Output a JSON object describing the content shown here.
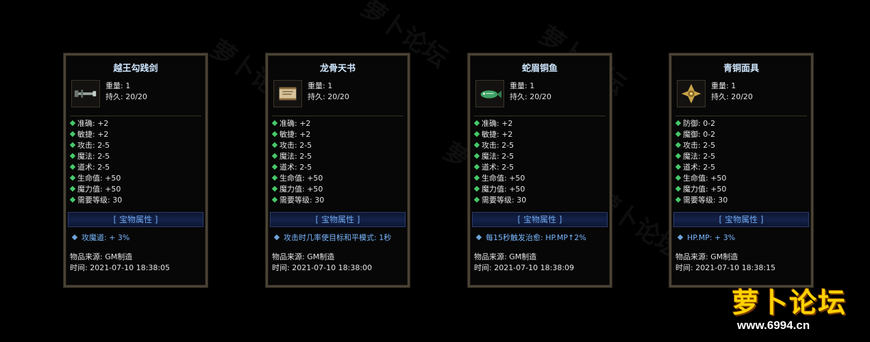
{
  "cards": [
    {
      "title": "越王勾践剑",
      "weight": "重量: 1",
      "durability": "持久: 20/20",
      "stats": [
        "准确: +2",
        "敏捷: +2",
        "攻击: 2-5",
        "魔法: 2-5",
        "道术: 2-5",
        "生命值: +50",
        "魔力值: +50",
        "需要等级: 30"
      ],
      "attr_title": "[ 宝物属性 ]",
      "special": "攻魔道: + 3%",
      "source": "物品来源: GM制造",
      "time": "时间: 2021-07-10 18:38:05",
      "icon": "sword-icon"
    },
    {
      "title": "龙骨天书",
      "weight": "重量: 1",
      "durability": "持久: 20/20",
      "stats": [
        "准确: +2",
        "敏捷: +2",
        "攻击: 2-5",
        "魔法: 2-5",
        "道术: 2-5",
        "生命值: +50",
        "魔力值: +50",
        "需要等级: 30"
      ],
      "attr_title": "[ 宝物属性 ]",
      "special": "攻击时几率使目标和平模式: 1秒",
      "source": "物品来源: GM制造",
      "time": "时间: 2021-07-10 18:38:00",
      "icon": "scroll-icon"
    },
    {
      "title": "蛇眉铜鱼",
      "weight": "重量: 1",
      "durability": "持久: 20/20",
      "stats": [
        "准确: +2",
        "敏捷: +2",
        "攻击: 2-5",
        "魔法: 2-5",
        "道术: 2-5",
        "生命值: +50",
        "魔力值: +50",
        "需要等级: 30"
      ],
      "attr_title": "[ 宝物属性 ]",
      "special": "每15秒触发治愈: HP.MP↑2%",
      "source": "物品来源: GM制造",
      "time": "时间: 2021-07-10 18:38:09",
      "icon": "jade-fish-icon"
    },
    {
      "title": "青铜面具",
      "weight": "重量: 1",
      "durability": "持久: 20/20",
      "stats": [
        "防御: 0-2",
        "魔御: 0-2",
        "攻击: 2-5",
        "魔法: 2-5",
        "道术: 2-5",
        "生命值: +50",
        "魔力值: +50",
        "需要等级: 30"
      ],
      "attr_title": "[ 宝物属性 ]",
      "special": "HP.MP: + 3%",
      "source": "物品来源: GM制造",
      "time": "时间: 2021-07-10 18:38:15",
      "icon": "bronze-mask-icon"
    }
  ],
  "logo": {
    "name": "萝卜论坛",
    "url": "www.6994.cn"
  },
  "watermark": "萝卜论坛"
}
